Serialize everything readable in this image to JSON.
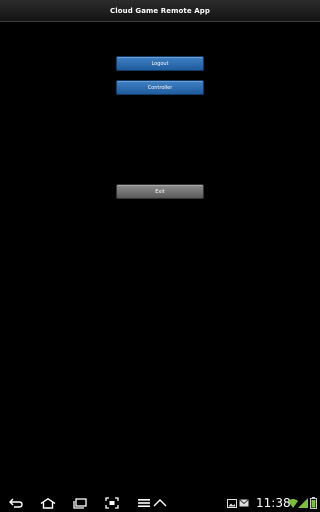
{
  "app": {
    "title": "Cloud Game Remote App"
  },
  "buttons": {
    "logout_label": "Logout",
    "controller_label": "Controller",
    "exit_label": "Exit"
  },
  "status_bar": {
    "time": "11:38"
  },
  "icons": {
    "back": "back-icon",
    "home": "home-icon",
    "recent_apps": "recent-apps-icon",
    "screenshot": "screenshot-icon",
    "menu": "menu-icon",
    "up": "chevron-up-icon",
    "gallery": "gallery-notification-icon",
    "mail": "mail-notification-icon",
    "wifi": "wifi-icon",
    "signal": "signal-icon",
    "battery": "battery-icon"
  },
  "colors": {
    "background": "#000000",
    "primary_button": "#2a6bb0",
    "secondary_button": "#747474",
    "text": "#ffffff"
  }
}
